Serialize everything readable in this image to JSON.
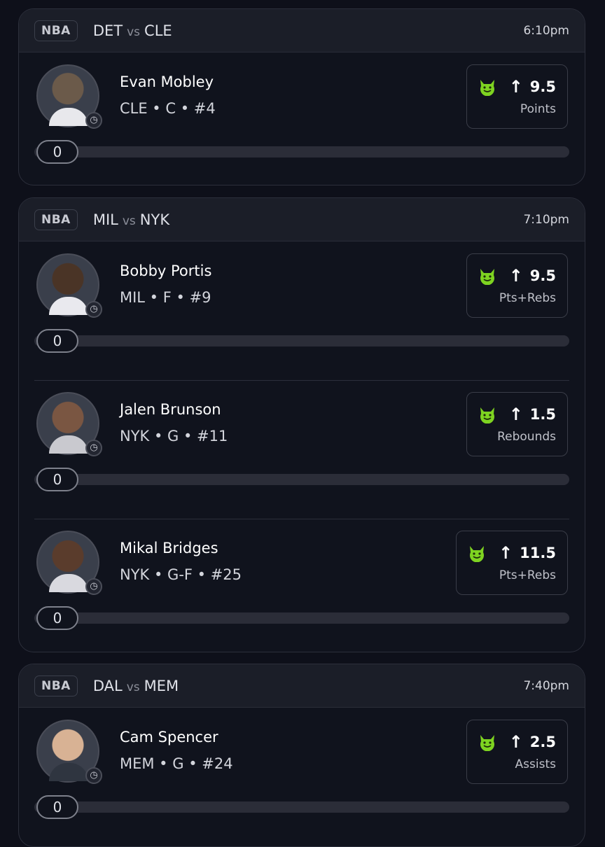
{
  "colors": {
    "accent_green": "#7ed321",
    "background": "#0e101a",
    "card": "#10131d"
  },
  "icons": {
    "pick_icon": "devil-face-icon",
    "direction_icon": "arrow-up-icon",
    "status_icon": "clock-icon"
  },
  "games": [
    {
      "league": "NBA",
      "home": "DET",
      "vs": "vs",
      "away": "CLE",
      "time": "6:10pm",
      "players": [
        {
          "name": "Evan Mobley",
          "meta": "CLE • C • #4",
          "direction": "↑",
          "line": "9.5",
          "stat": "Points",
          "progress_value": "0",
          "progress_fraction": 0
        }
      ]
    },
    {
      "league": "NBA",
      "home": "MIL",
      "vs": "vs",
      "away": "NYK",
      "time": "7:10pm",
      "players": [
        {
          "name": "Bobby Portis",
          "meta": "MIL • F • #9",
          "direction": "↑",
          "line": "9.5",
          "stat": "Pts+Rebs",
          "progress_value": "0",
          "progress_fraction": 0
        },
        {
          "name": "Jalen Brunson",
          "meta": "NYK • G • #11",
          "direction": "↑",
          "line": "1.5",
          "stat": "Rebounds",
          "progress_value": "0",
          "progress_fraction": 0
        },
        {
          "name": "Mikal Bridges",
          "meta": "NYK • G-F • #25",
          "direction": "↑",
          "line": "11.5",
          "stat": "Pts+Rebs",
          "progress_value": "0",
          "progress_fraction": 0
        }
      ]
    },
    {
      "league": "NBA",
      "home": "DAL",
      "vs": "vs",
      "away": "MEM",
      "time": "7:40pm",
      "players": [
        {
          "name": "Cam Spencer",
          "meta": "MEM • G • #24",
          "direction": "↑",
          "line": "2.5",
          "stat": "Assists",
          "progress_value": "0",
          "progress_fraction": 0
        }
      ]
    }
  ]
}
